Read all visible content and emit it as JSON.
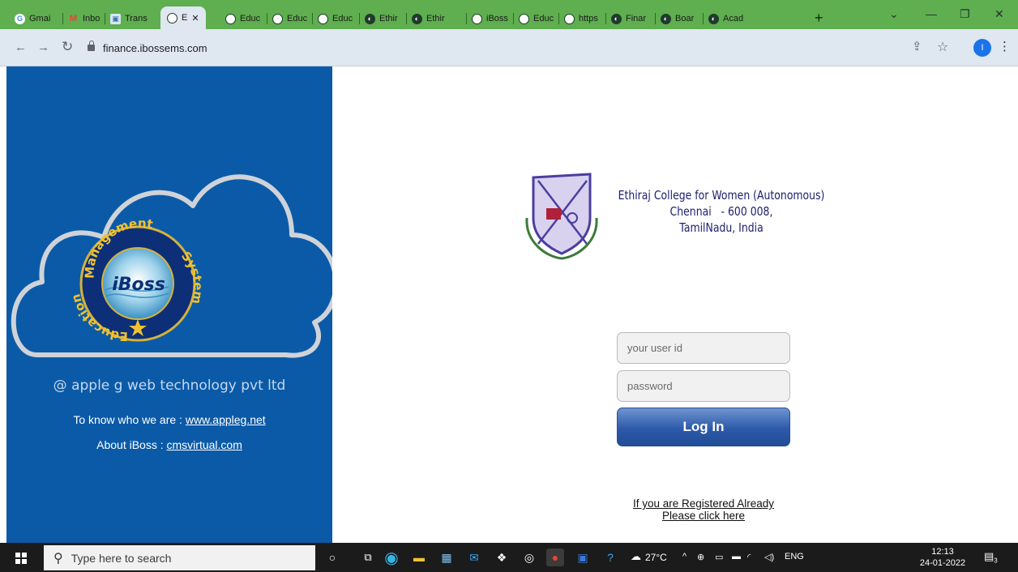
{
  "browser": {
    "tabs": [
      {
        "label": "Gmai",
        "icon": "google-icon"
      },
      {
        "label": "Inbo",
        "icon": "gmail-icon"
      },
      {
        "label": "Trans",
        "icon": "image-icon"
      },
      {
        "label": "E",
        "icon": "circle-icon",
        "active": true
      },
      {
        "label": "Educ",
        "icon": "circle-icon"
      },
      {
        "label": "Educ",
        "icon": "circle-icon"
      },
      {
        "label": "Educ",
        "icon": "circle-icon"
      },
      {
        "label": "Ethir",
        "icon": "globe-icon"
      },
      {
        "label": "Ethir",
        "icon": "globe-icon"
      },
      {
        "label": "iBoss",
        "icon": "circle-icon"
      },
      {
        "label": "Educ",
        "icon": "circle-icon"
      },
      {
        "label": "https",
        "icon": "circle-icon"
      },
      {
        "label": "Finar",
        "icon": "globe-icon"
      },
      {
        "label": "Boar",
        "icon": "globe-icon"
      },
      {
        "label": "Acad",
        "icon": "globe-icon"
      }
    ],
    "new_tab": "+",
    "url": "finance.ibossems.com",
    "profile_initial": "I",
    "accent": "#5fae4f"
  },
  "left_panel": {
    "badge": {
      "top_text": "Management",
      "left_text": "Education",
      "right_text": "System",
      "center_text": "iBoss"
    },
    "brand": "@ apple g web technology pvt ltd",
    "know_prefix": "To know who we are : ",
    "know_link": "www.appleg.net",
    "about_prefix": "About iBoss : ",
    "about_link": "cmsvirtual.com",
    "bg_color": "#0b5aa8"
  },
  "college": {
    "name": "Ethiraj College for Women (Autonomous)",
    "city": "Chennai   - 600 008,",
    "state": "TamilNadu, India"
  },
  "login": {
    "user_placeholder": "your user id",
    "password_placeholder": "password",
    "button_label": "Log In",
    "registered_line1": "If you are Registered Already",
    "registered_line2": "Please click here"
  },
  "taskbar": {
    "search_placeholder": "Type here to search",
    "temperature": "27°C",
    "language": "ENG",
    "time": "12:13",
    "date": "24-01-2022",
    "notification_count": "3"
  }
}
